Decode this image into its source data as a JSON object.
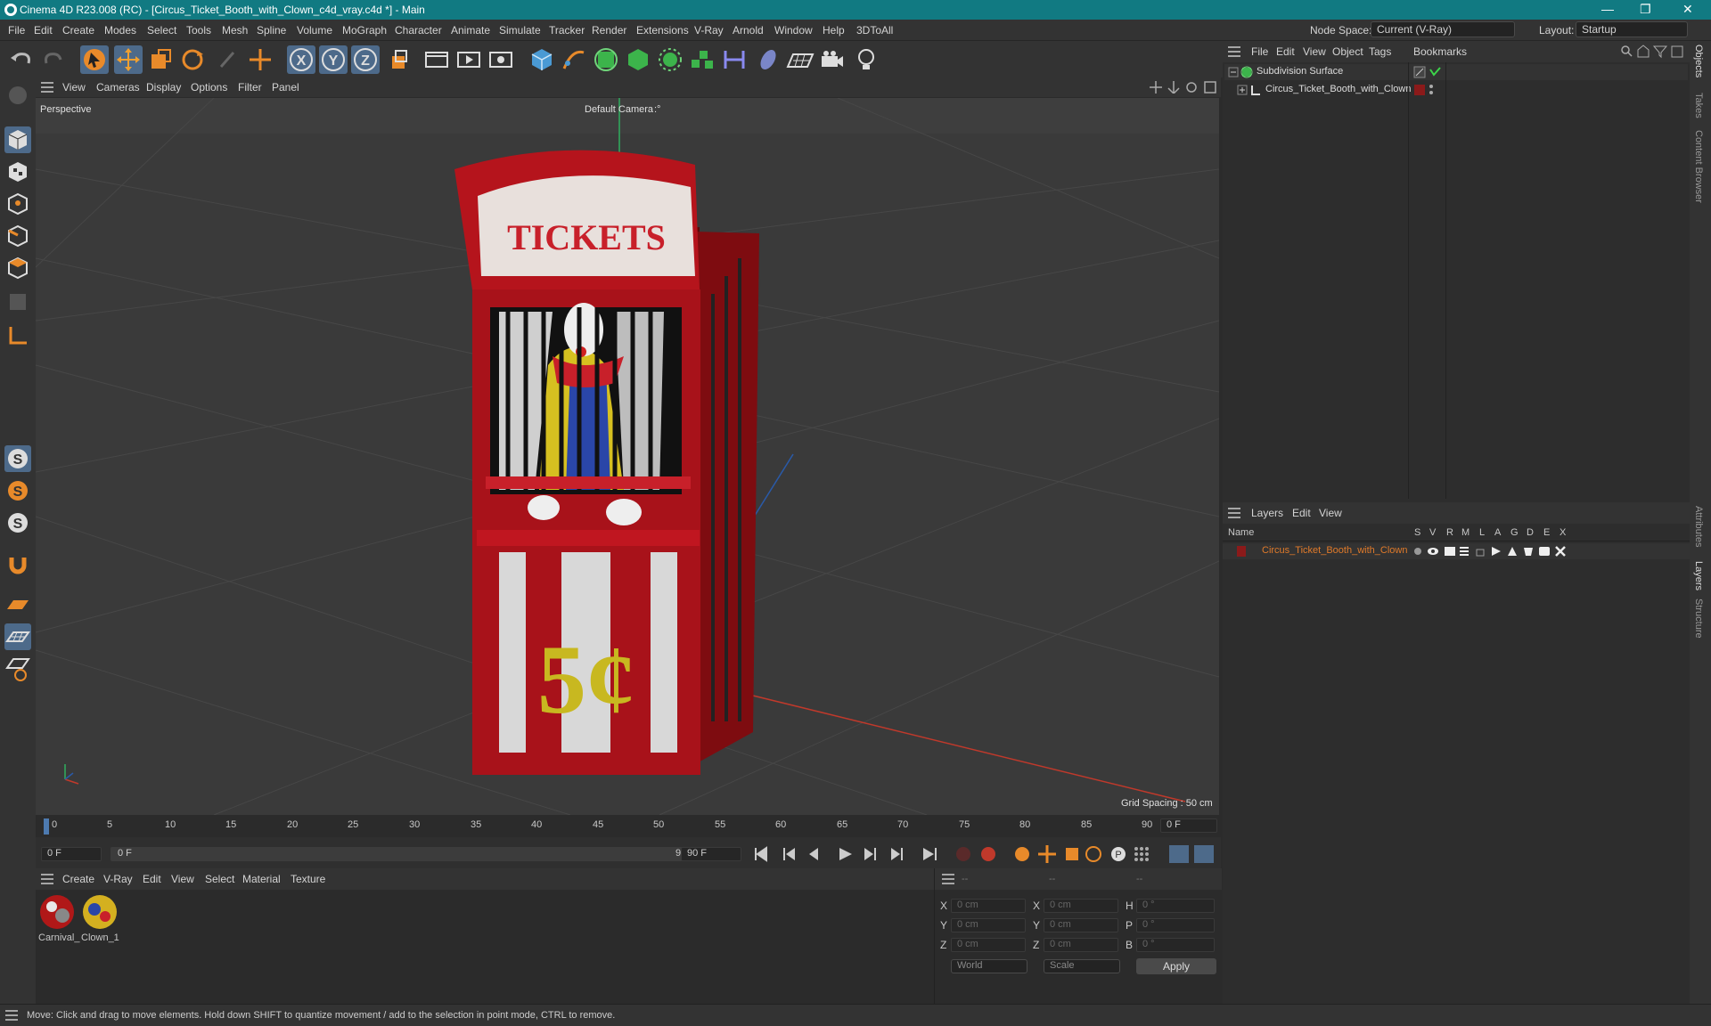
{
  "titlebar": {
    "title": "Cinema 4D R23.008 (RC) - [Circus_Ticket_Booth_with_Clown_c4d_vray.c4d *] - Main",
    "minimize": "—",
    "maximize": "❐",
    "close": "✕"
  },
  "menubar": {
    "items": [
      "File",
      "Edit",
      "Create",
      "Modes",
      "Select",
      "Tools",
      "Mesh",
      "Spline",
      "Volume",
      "MoGraph",
      "Character",
      "Animate",
      "Simulate",
      "Tracker",
      "Render",
      "Extensions",
      "V-Ray",
      "Arnold",
      "Window",
      "Help",
      "3DToAll"
    ],
    "node_space_label": "Node Space:",
    "node_space_value": "Current (V-Ray)",
    "layout_label": "Layout:",
    "layout_value": "Startup"
  },
  "viewport": {
    "menu": [
      "View",
      "Cameras",
      "Display",
      "Options",
      "Filter",
      "Panel"
    ],
    "projection": "Perspective",
    "camera": "Default Camera",
    "camera_suffix": ":°",
    "grid_spacing": "Grid Spacing : 50 cm",
    "sign_text": "TICKETS",
    "price_text": "5¢"
  },
  "timeline": {
    "ticks": [
      "0",
      "5",
      "10",
      "15",
      "20",
      "25",
      "30",
      "35",
      "40",
      "45",
      "50",
      "55",
      "60",
      "65",
      "70",
      "75",
      "80",
      "85",
      "90"
    ],
    "current_frame": "0 F",
    "start_frame": "0 F",
    "range_start": "0 F",
    "range_end": "90 F",
    "end_frame": "90 F"
  },
  "materials": {
    "menu": [
      "Create",
      "V-Ray",
      "Edit",
      "View",
      "Select",
      "Material",
      "Texture"
    ],
    "items": [
      {
        "name": "Carnival_"
      },
      {
        "name": "Clown_1"
      }
    ]
  },
  "coords": {
    "headers": [
      "--",
      "--",
      "--"
    ],
    "rows": [
      {
        "a": "X",
        "a_val": "0 cm",
        "b": "X",
        "b_val": "0 cm",
        "c": "H",
        "c_val": "0 °"
      },
      {
        "a": "Y",
        "a_val": "0 cm",
        "b": "Y",
        "b_val": "0 cm",
        "c": "P",
        "c_val": "0 °"
      },
      {
        "a": "Z",
        "a_val": "0 cm",
        "b": "Z",
        "b_val": "0 cm",
        "c": "B",
        "c_val": "0 °"
      }
    ],
    "coord_system": "World",
    "mode": "Scale",
    "apply": "Apply"
  },
  "objects": {
    "menu": [
      "File",
      "Edit",
      "View",
      "Object",
      "Tags",
      "Bookmarks"
    ],
    "tree": [
      {
        "name": "Subdivision Surface"
      },
      {
        "name": "Circus_Ticket_Booth_with_Clown"
      }
    ]
  },
  "layers": {
    "menu": [
      "Layers",
      "Edit",
      "View"
    ],
    "columns": {
      "name": "Name",
      "flags": [
        "S",
        "V",
        "R",
        "M",
        "L",
        "A",
        "G",
        "D",
        "E",
        "X"
      ]
    },
    "rows": [
      {
        "name": "Circus_Ticket_Booth_with_Clown",
        "color": "#8b1a1a"
      }
    ]
  },
  "right_tabs": [
    "Objects",
    "Takes",
    "Content Browser",
    "Attributes",
    "Layers",
    "Structure"
  ],
  "status": "Move: Click and drag to move elements. Hold down SHIFT to quantize movement / add to the selection in point mode, CTRL to remove.",
  "colors": {
    "accent": "#117a82",
    "active_tool": "#4d6a8a",
    "layer_text": "#e07a2a",
    "booth_red": "#a8121a"
  }
}
